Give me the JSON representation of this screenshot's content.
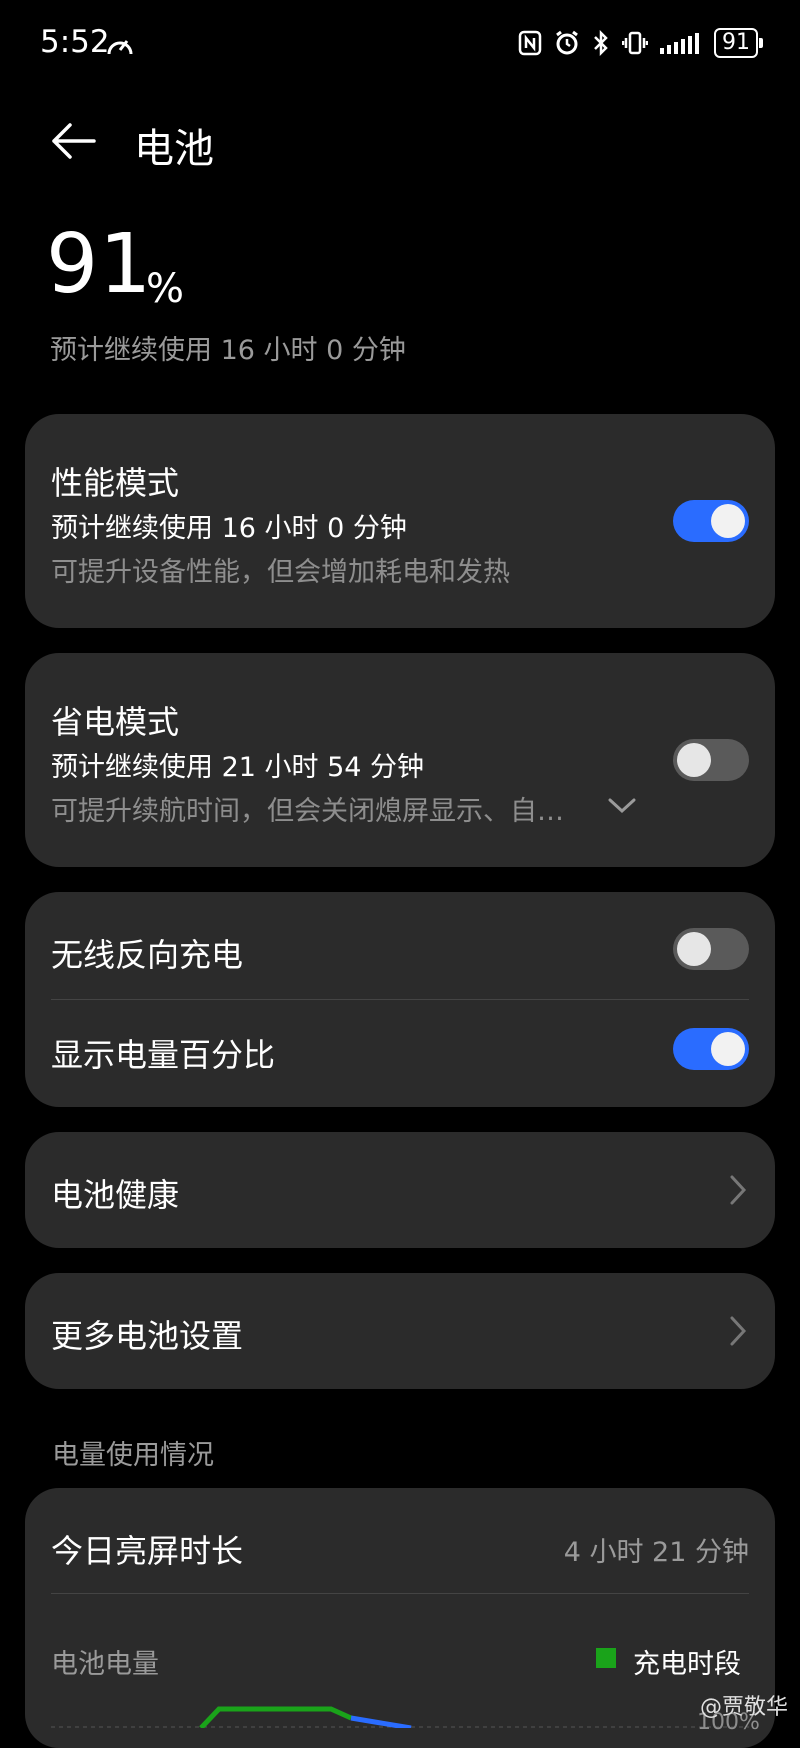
{
  "status_bar": {
    "time": "5:52",
    "battery": "91",
    "icons": [
      "speed-icon",
      "nfc-icon",
      "alarm-icon",
      "bluetooth-icon",
      "vibrate-icon",
      "signal-icon",
      "battery-icon"
    ]
  },
  "header": {
    "title": "电池"
  },
  "battery": {
    "percent": "91",
    "percent_sign": "%",
    "estimate": "预计继续使用 16 小时 0 分钟"
  },
  "performance_mode": {
    "title": "性能模式",
    "estimate": "预计继续使用 16 小时 0 分钟",
    "desc": "可提升设备性能，但会增加耗电和发热",
    "enabled": true
  },
  "power_saving_mode": {
    "title": "省电模式",
    "estimate": "预计继续使用 21 小时 54 分钟",
    "desc": "可提升续航时间，但会关闭熄屏显示、自…",
    "enabled": false
  },
  "toggles_card": {
    "wireless_reverse": {
      "label": "无线反向充电",
      "enabled": false
    },
    "show_percent": {
      "label": "显示电量百分比",
      "enabled": true
    }
  },
  "battery_health": {
    "label": "电池健康"
  },
  "more_settings": {
    "label": "更多电池设置"
  },
  "usage": {
    "section_title": "电量使用情况",
    "screen_time_label": "今日亮屏时长",
    "screen_time_value": "4 小时 21 分钟",
    "battery_level_label": "电池电量",
    "legend_charging": "充电时段",
    "axis_top": "100%"
  },
  "watermark": "@贾敬华",
  "colors": {
    "accent": "#2a6cff",
    "card": "#2b2b2b",
    "charging": "#1aa31a"
  }
}
